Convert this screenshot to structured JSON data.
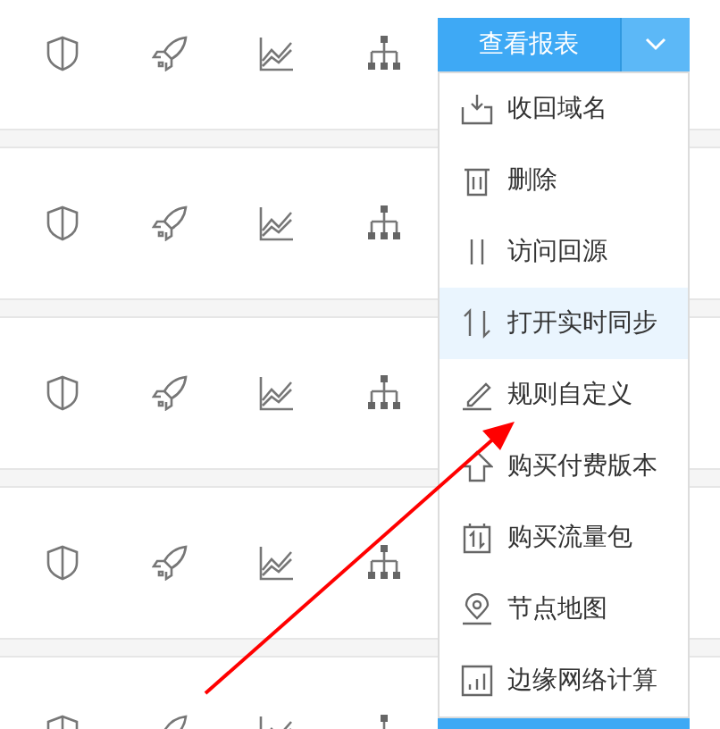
{
  "rows": [
    {
      "button": {
        "label": "查看报表"
      }
    },
    {},
    {},
    {},
    {
      "button_peek": true
    }
  ],
  "menu": {
    "items": [
      {
        "kind": "recall",
        "label": "收回域名",
        "selected": false
      },
      {
        "kind": "delete",
        "label": "删除",
        "selected": false
      },
      {
        "kind": "origin",
        "label": "访问回源",
        "selected": false
      },
      {
        "kind": "sync",
        "label": "打开实时同步",
        "selected": true
      },
      {
        "kind": "edit",
        "label": "规则自定义",
        "selected": false
      },
      {
        "kind": "upgrade",
        "label": "购买付费版本",
        "selected": false
      },
      {
        "kind": "package",
        "label": "购买流量包",
        "selected": false
      },
      {
        "kind": "map",
        "label": "节点地图",
        "selected": false
      },
      {
        "kind": "compute",
        "label": "边缘网络计算",
        "selected": false
      }
    ]
  }
}
